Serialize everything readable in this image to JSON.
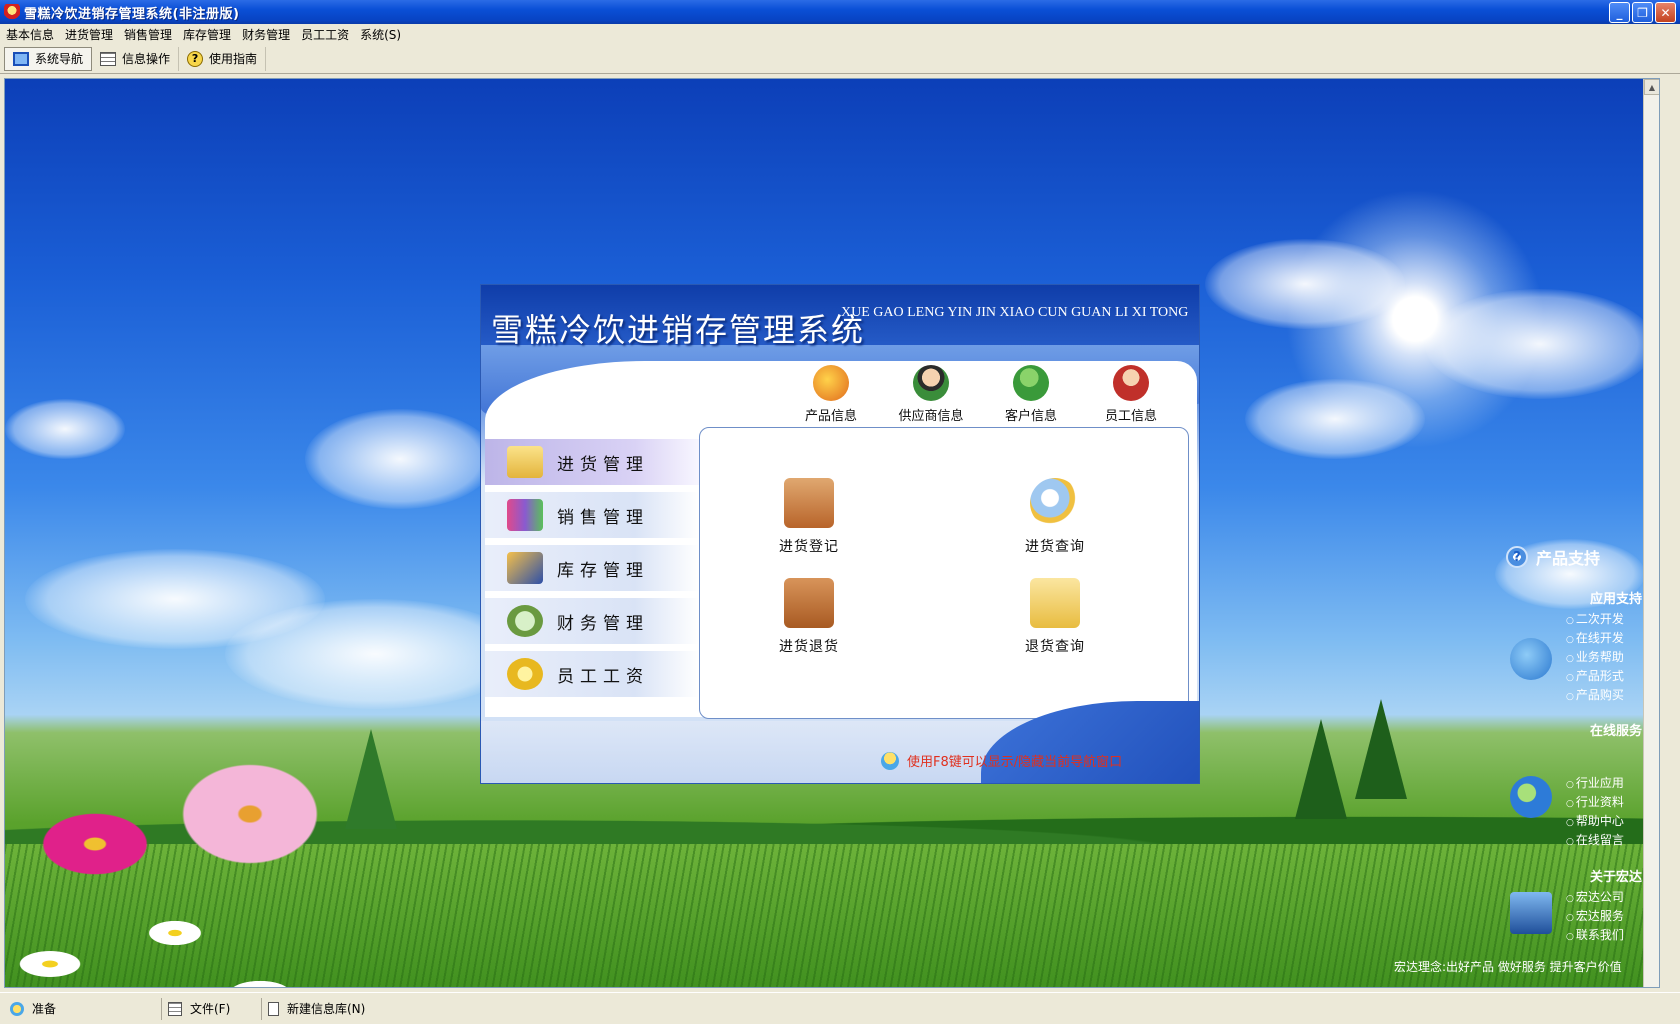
{
  "window": {
    "title": "雪糕冷饮进销存管理系统(非注册版)",
    "controls": [
      "minimize-icon",
      "restore-icon",
      "close-icon"
    ]
  },
  "menubar": {
    "items": [
      "基本信息",
      "进货管理",
      "销售管理",
      "库存管理",
      "财务管理",
      "员工工资",
      "系统(S)"
    ]
  },
  "toolbar": {
    "items": [
      {
        "label": "系统导航",
        "icon": "navigation-icon",
        "active": true
      },
      {
        "label": "信息操作",
        "icon": "grid-icon",
        "active": false
      },
      {
        "label": "使用指南",
        "icon": "help-icon",
        "active": false
      }
    ]
  },
  "panel": {
    "title": "雪糕冷饮进销存管理系统",
    "subtitle": "XUE GAO LENG YIN JIN XIAO CUN GUAN LI XI TONG",
    "quick_links": [
      {
        "label": "产品信息",
        "icon": "product-info-icon"
      },
      {
        "label": "供应商信息",
        "icon": "supplier-info-icon"
      },
      {
        "label": "客户信息",
        "icon": "customer-info-icon"
      },
      {
        "label": "员工信息",
        "icon": "employee-info-icon"
      }
    ],
    "side_menu": [
      {
        "label": "进货管理",
        "icon": "purchase-folder-icon",
        "active": true
      },
      {
        "label": "销售管理",
        "icon": "sales-books-icon",
        "active": false
      },
      {
        "label": "库存管理",
        "icon": "inventory-book-icon",
        "active": false
      },
      {
        "label": "财务管理",
        "icon": "finance-magnifier-icon",
        "active": false
      },
      {
        "label": "员工工资",
        "icon": "salary-coins-icon",
        "active": false
      }
    ],
    "actions": [
      {
        "label": "进货登记",
        "icon": "purchase-register-icon"
      },
      {
        "label": "进货查询",
        "icon": "purchase-query-icon"
      },
      {
        "label": "进货退货",
        "icon": "purchase-return-icon"
      },
      {
        "label": "退货查询",
        "icon": "return-query-icon"
      }
    ],
    "hint": "使用F8键可以显示/隐藏当前导航窗口"
  },
  "support": {
    "title": "产品支持",
    "sections": [
      {
        "title": "应用支持",
        "items": [
          "二次开发",
          "在线开发",
          "业务帮助",
          "产品形式",
          "产品购买"
        ]
      },
      {
        "title": "在线服务",
        "items": [
          "行业应用",
          "行业资料",
          "帮助中心",
          "在线留言"
        ]
      },
      {
        "title": "关于宏达",
        "items": [
          "宏达公司",
          "宏达服务",
          "联系我们"
        ]
      }
    ],
    "tagline": "宏达理念:出好产品 做好服务 提升客户价值"
  },
  "statusbar": {
    "status": "准备",
    "file": "文件(F)",
    "new_db": "新建信息库(N)"
  },
  "colors": {
    "title_bar": "#0a4fd6",
    "hint_text": "#e0301e",
    "panel_blue": "#2e6ad5"
  }
}
